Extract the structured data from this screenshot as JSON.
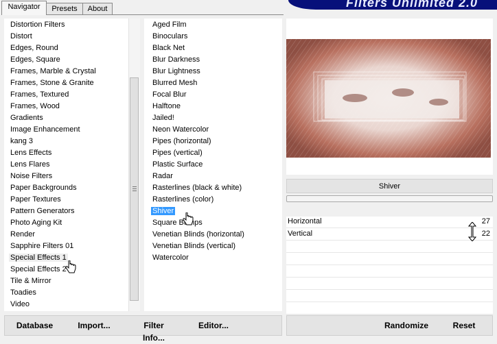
{
  "window": {
    "banner_title": "Filters Unlimited 2.0",
    "tabs": [
      {
        "label": "Navigator",
        "active": true
      },
      {
        "label": "Presets",
        "active": false
      },
      {
        "label": "About",
        "active": false
      }
    ]
  },
  "categories": {
    "items": [
      "Distortion Filters",
      "Distort",
      "Edges, Round",
      "Edges, Square",
      "Frames, Marble & Crystal",
      "Frames, Stone & Granite",
      "Frames, Textured",
      "Frames, Wood",
      "Gradients",
      "Image Enhancement",
      "kang 3",
      "Lens Effects",
      "Lens Flares",
      "Noise Filters",
      "Paper Backgrounds",
      "Paper Textures",
      "Pattern Generators",
      "Photo Aging Kit",
      "Render",
      "Sapphire Filters 01",
      "Special Effects 1",
      "Special Effects 2",
      "Tile & Mirror",
      "Toadies",
      "Video"
    ],
    "selected": "Special Effects 1"
  },
  "filters": {
    "items": [
      "Aged Film",
      "Binoculars",
      "Black Net",
      "Blur Darkness",
      "Blur Lightness",
      "Blurred Mesh",
      "Focal Blur",
      "Halftone",
      "Jailed!",
      "Neon Watercolor",
      "Pipes (horizontal)",
      "Pipes (vertical)",
      "Plastic Surface",
      "Radar",
      "Rasterlines (black & white)",
      "Rasterlines (color)",
      "Shiver",
      "Square Bumps",
      "Venetian Blinds (horizontal)",
      "Venetian Blinds (vertical)",
      "Watercolor"
    ],
    "selected": "Shiver"
  },
  "preview": {
    "filter_name": "Shiver",
    "colors": {
      "base": "#c98a78",
      "dark": "#8e4f43",
      "light": "#f6eeea"
    }
  },
  "params": [
    {
      "label": "Horizontal",
      "value": "27"
    },
    {
      "label": "Vertical",
      "value": "22"
    }
  ],
  "buttons": {
    "database": "Database",
    "import": "Import...",
    "filter_info": "Filter Info...",
    "editor": "Editor...",
    "randomize": "Randomize",
    "reset": "Reset"
  },
  "colors": {
    "selection": "#3399ff",
    "banner": "#07107a"
  }
}
